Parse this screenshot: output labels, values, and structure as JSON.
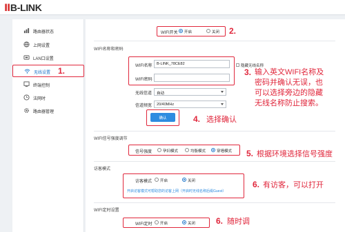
{
  "header": {
    "logo_main": "B-LINK",
    "logo_prefix": "",
    "right_text": ""
  },
  "sidebar": {
    "items": [
      {
        "label": "路由器状态",
        "icon": "dashboard-icon"
      },
      {
        "label": "上网设置",
        "icon": "globe-icon"
      },
      {
        "label": "LAN口设置",
        "icon": "lan-icon"
      },
      {
        "label": "无线设置",
        "icon": "wifi-icon"
      },
      {
        "label": "终端控制",
        "icon": "terminal-icon"
      },
      {
        "label": "法网时",
        "icon": "clock-icon"
      },
      {
        "label": "路由器管理",
        "icon": "gear-icon"
      }
    ]
  },
  "wifi_switch": {
    "label": "WIFI开关",
    "on": "开启",
    "off": "关闭"
  },
  "ssid_section": {
    "title": "WIFI名称和密码",
    "name_label": "WIFI名称",
    "name_value": "B-LINK_78CE82",
    "pwd_label": "WIFI密码",
    "pwd_value": "",
    "hide_label": "隐藏无线名称",
    "channel_label": "无线信道",
    "channel_value": "自动",
    "bandwidth_label": "信道频宽",
    "bandwidth_value": "20/40MHz",
    "confirm_label": "确认"
  },
  "signal_section": {
    "title": "WIFI信号强度调节",
    "label": "信号强度",
    "opt1": "孕妇模式",
    "opt2": "均衡模式",
    "opt3": "穿墙模式"
  },
  "guest_section": {
    "title": "访客模式",
    "label": "访客模式",
    "on": "开启",
    "off": "关闭",
    "hint": "开启访客模式可帮助您的访客上网（开启时无线名称后缀Guest）"
  },
  "timer_section": {
    "title": "WIFI定时设置",
    "label": "WIFI定时",
    "on": "开启",
    "off": "关闭"
  },
  "annotations": {
    "a1_num": "1.",
    "a2_num": "2.",
    "a3_num": "3.",
    "a3_text_1": "输入英文WIFI名称及",
    "a3_text_2": "密码并确认无误，也",
    "a3_text_3": "可以选择旁边的隐藏",
    "a3_text_4": "无线名称防止搜索。",
    "a4_num": "4.",
    "a4_text": "选择确认",
    "a5_num": "5.",
    "a5_text": "根据环境选择信号强度",
    "a6_num": "6.",
    "a6_text": "有访客，可以打开",
    "a6b_num": "6.",
    "a6b_text": "随时调"
  },
  "colors": {
    "accent": "#e0263b",
    "primary": "#2d8ce0"
  }
}
